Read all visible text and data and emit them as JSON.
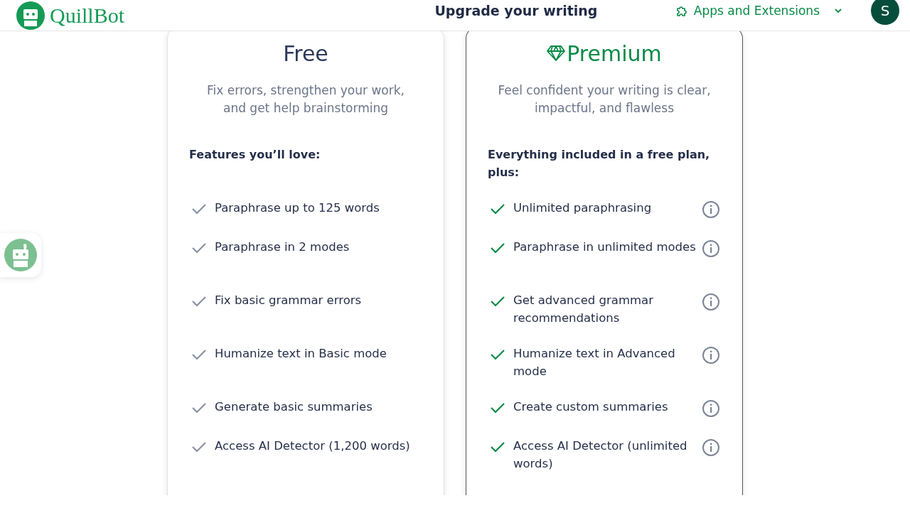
{
  "header": {
    "logo_text": "QuillBot",
    "title": "Upgrade your writing",
    "apps_menu": {
      "label": "Apps and Extensions",
      "expanded": false
    },
    "avatar": "S"
  },
  "plans": [
    {
      "kind": "free",
      "name": "Free",
      "description": "Fix errors, strengthen your work, and get help brainstorming",
      "features_heading": "Features you’ll love:",
      "features": [
        {
          "text": "Paraphrase up to 125 words",
          "info": false
        },
        {
          "text": "Paraphrase in 2 modes",
          "info": false
        },
        {
          "text": "Fix basic grammar errors",
          "info": false
        },
        {
          "text": "Humanize text in Basic mode",
          "info": false
        },
        {
          "text": "Generate basic summaries",
          "info": false
        },
        {
          "text": "Access AI Detector (1,200 words)",
          "info": false
        }
      ]
    },
    {
      "kind": "premium",
      "name": "Premium",
      "description": "Feel confident your writing is clear, impactful, and flawless",
      "features_heading": "Everything included in a free plan, plus:",
      "features": [
        {
          "text": "Unlimited paraphrasing",
          "info": true
        },
        {
          "text": "Paraphrase in unlimited modes",
          "info": true
        },
        {
          "text": "Get advanced grammar recommendations",
          "info": true
        },
        {
          "text": "Humanize text in Advanced mode",
          "info": true
        },
        {
          "text": "Create custom summaries",
          "info": true
        },
        {
          "text": "Access AI Detector (unlimited words)",
          "info": true
        }
      ]
    }
  ]
}
